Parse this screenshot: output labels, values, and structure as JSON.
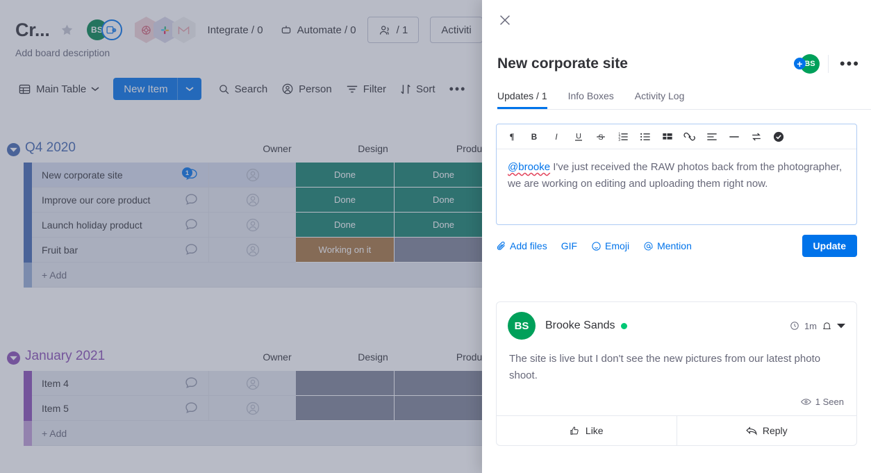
{
  "board": {
    "title": "Cr...",
    "description": "Add board description",
    "integrate_label": "Integrate / 0",
    "automate_label": "Automate / 0",
    "members_count": "/ 1",
    "activities_label": "Activiti",
    "avatar_initials": "BS",
    "icons": {
      "star": "star-icon",
      "board_view": "board-view-icon",
      "hex1": "integration-monday-icon",
      "hex2": "integration-slack-icon",
      "hex3": "integration-gmail-icon",
      "people": "people-icon",
      "robot": "robot-icon"
    },
    "toolbar": {
      "view_label": "Main Table",
      "new_item_label": "New Item",
      "search_label": "Search",
      "person_label": "Person",
      "filter_label": "Filter",
      "sort_label": "Sort",
      "more_label": "•••"
    },
    "columns": [
      "Owner",
      "Design",
      "Product"
    ],
    "groups": [
      {
        "name": "Q4 2020",
        "color": "#4268b0",
        "title_color": "#4268b0",
        "add_label": "+ Add",
        "rows": [
          {
            "name": "New corporate site",
            "selected": true,
            "updates_badge": "1",
            "design": {
              "label": "Done",
              "color": "#13826b"
            },
            "product": {
              "label": "Done",
              "color": "#13826b"
            }
          },
          {
            "name": "Improve our core product",
            "selected": false,
            "updates_badge": "",
            "design": {
              "label": "Done",
              "color": "#13826b"
            },
            "product": {
              "label": "Done",
              "color": "#13826b"
            }
          },
          {
            "name": "Launch holiday product",
            "selected": false,
            "updates_badge": "",
            "design": {
              "label": "Done",
              "color": "#13826b"
            },
            "product": {
              "label": "Done",
              "color": "#13826b"
            }
          },
          {
            "name": "Fruit bar",
            "selected": false,
            "updates_badge": "",
            "design": {
              "label": "Working on it",
              "color": "#a8763e"
            },
            "product": {
              "label": "",
              "color": "#7f8496"
            }
          }
        ]
      },
      {
        "name": "January 2021",
        "color": "#8a4fb5",
        "title_color": "#8a4fb5",
        "add_label": "+ Add",
        "rows": [
          {
            "name": "Item 4",
            "selected": false,
            "updates_badge": "",
            "design": {
              "label": "",
              "color": "#7f8496"
            },
            "product": {
              "label": "",
              "color": "#7f8496"
            }
          },
          {
            "name": "Item 5",
            "selected": false,
            "updates_badge": "",
            "design": {
              "label": "",
              "color": "#7f8496"
            },
            "product": {
              "label": "",
              "color": "#7f8496"
            }
          }
        ]
      }
    ]
  },
  "panel": {
    "item_title": "New corporate site",
    "avatar_initials": "BS",
    "add_subscriber_glyph": "+",
    "more_glyph": "•••",
    "tabs": [
      {
        "label": "Updates / 1",
        "active": true
      },
      {
        "label": "Info Boxes",
        "active": false
      },
      {
        "label": "Activity Log",
        "active": false
      }
    ],
    "editor": {
      "toolbar_icons": [
        "paragraph-icon",
        "bold-icon",
        "italic-icon",
        "underline-icon",
        "strikethrough-icon",
        "ordered-list-icon",
        "bullet-list-icon",
        "table-icon",
        "link-icon",
        "align-icon",
        "horizontal-rule-icon",
        "swap-icon",
        "check-circle-icon"
      ],
      "mention": "@brooke",
      "text": " I've just received the RAW photos back from the photographer, we are working on editing and uploading them right now.",
      "actions": [
        {
          "label": "Add files",
          "icon": "paperclip-icon"
        },
        {
          "label": "GIF",
          "icon": ""
        },
        {
          "label": "Emoji",
          "icon": "emoji-icon"
        },
        {
          "label": "Mention",
          "icon": "at-icon"
        }
      ],
      "update_button": "Update"
    },
    "comment": {
      "avatar_initials": "BS",
      "author": "Brooke Sands",
      "time": "1m",
      "body": "The site is live but I don't see the new pictures from our latest photo shoot.",
      "seen_label": "1 Seen",
      "like_label": "Like",
      "reply_label": "Reply",
      "clock_icon": "clock-icon",
      "bell_icon": "bell-icon",
      "chevron_icon": "chevron-down-icon",
      "eye_icon": "eye-icon",
      "like_icon": "thumbs-up-icon",
      "reply_icon": "reply-arrow-icon"
    }
  },
  "colors": {
    "accent": "#0073ea",
    "done": "#13826b",
    "working": "#a8763e",
    "empty": "#7f8496",
    "green_avatar": "#00a05a"
  }
}
